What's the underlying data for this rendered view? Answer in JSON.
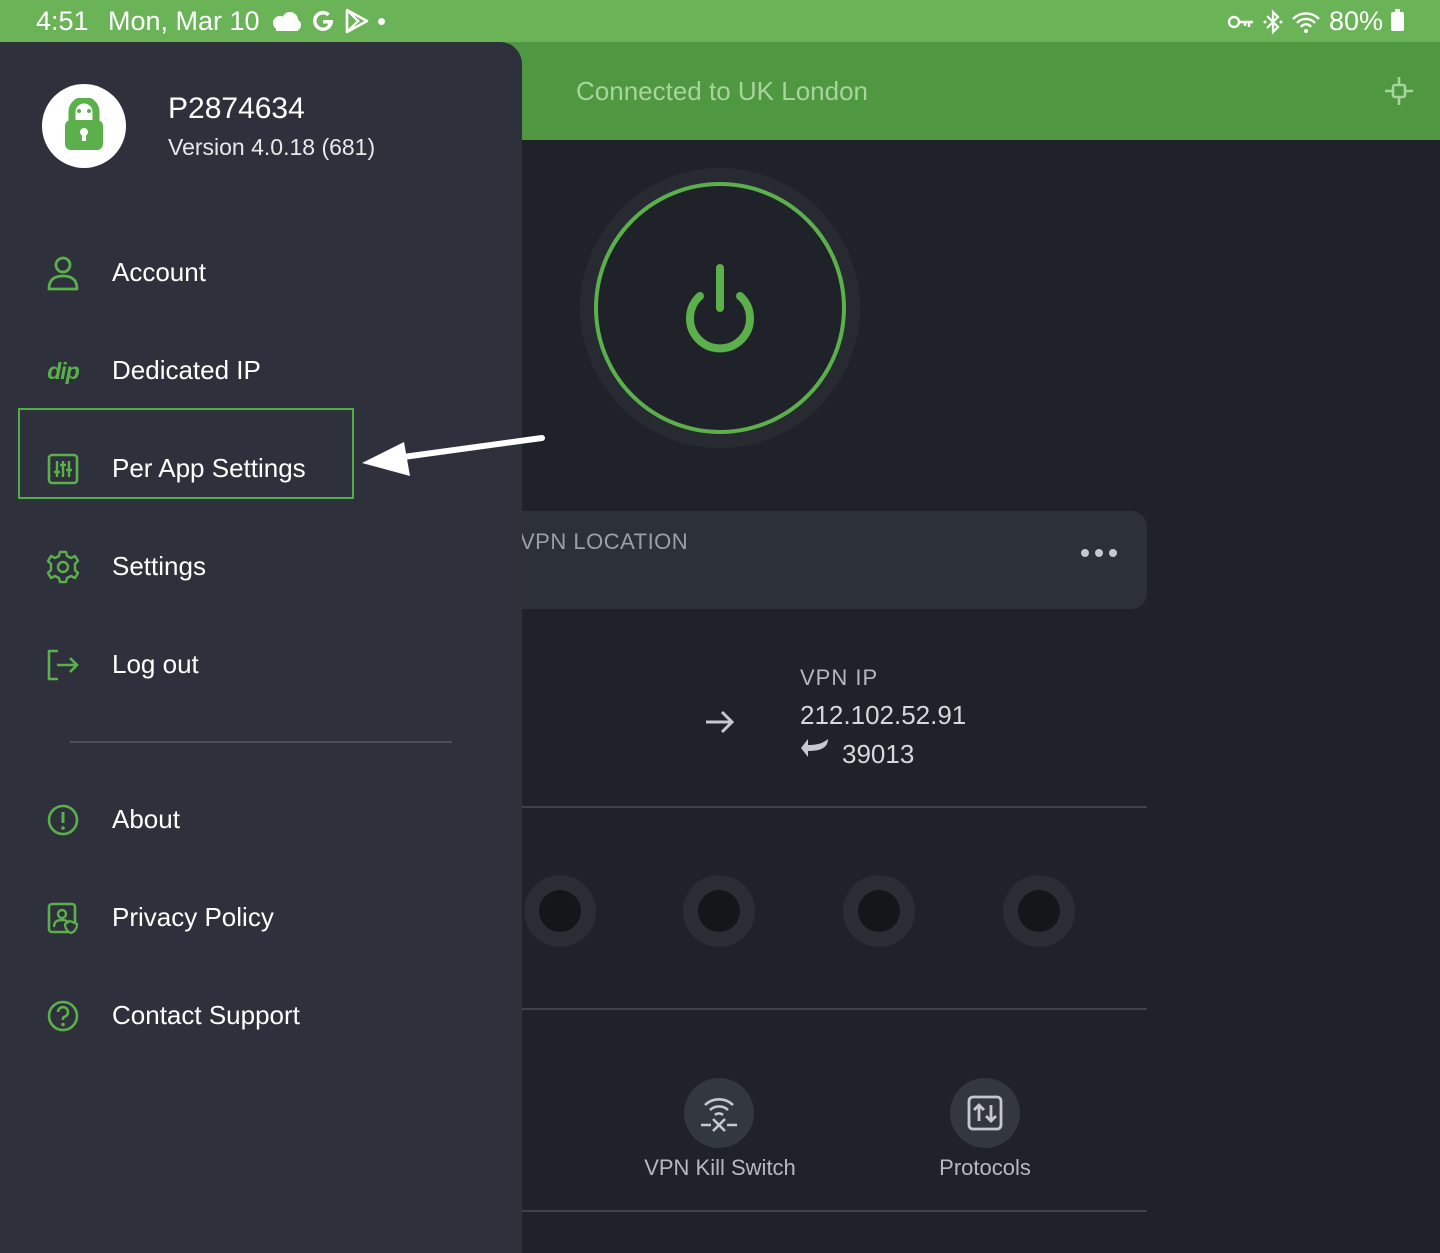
{
  "status_bar": {
    "time": "4:51",
    "date": "Mon, Mar 10",
    "battery": "80%",
    "icons_left": [
      "cloud-icon",
      "google-icon",
      "play-store-icon",
      "dot-icon"
    ],
    "icons_right": [
      "vpn-key-icon",
      "bluetooth-icon",
      "wifi-icon",
      "battery-icon"
    ]
  },
  "header": {
    "title": "Connected to UK London"
  },
  "main": {
    "location_label": "VPN LOCATION",
    "vpn_ip_label": "VPN IP",
    "vpn_ip_value": "212.102.52.91",
    "port": "39013",
    "quick_actions": [
      {
        "label": "VPN Kill Switch",
        "icon": "kill-switch-icon"
      },
      {
        "label": "Protocols",
        "icon": "protocols-icon"
      }
    ]
  },
  "drawer": {
    "username": "P2874634",
    "version": "Version 4.0.18 (681)",
    "menu": [
      {
        "label": "Account",
        "icon": "person-icon"
      },
      {
        "label": "Dedicated IP",
        "icon": "dip-icon",
        "icon_text": "dip"
      },
      {
        "label": "Per App Settings",
        "icon": "sliders-icon"
      },
      {
        "label": "Settings",
        "icon": "gear-icon"
      },
      {
        "label": "Log out",
        "icon": "logout-icon"
      },
      {
        "label": "About",
        "icon": "info-icon"
      },
      {
        "label": "Privacy Policy",
        "icon": "privacy-icon"
      },
      {
        "label": "Contact Support",
        "icon": "help-icon"
      }
    ]
  },
  "colors": {
    "status_bar": "#6ab457",
    "header": "#4f9741",
    "accent": "#5bb04c",
    "drawer_bg": "#2e313b",
    "app_bg": "#1f2228"
  }
}
